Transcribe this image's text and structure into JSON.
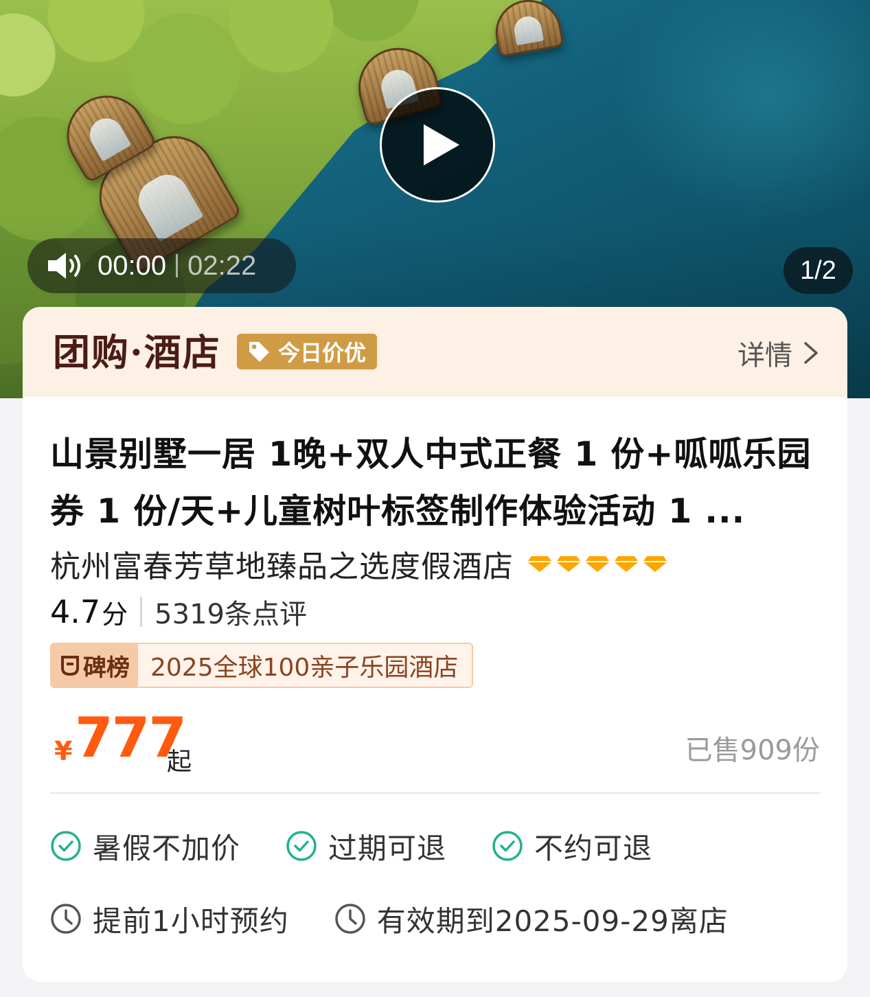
{
  "media": {
    "current_time": "00:00",
    "total_time": "02:22",
    "page_counter": "1/2"
  },
  "header": {
    "brand_title": "团购·酒店",
    "deal_badge": "今日价优",
    "details_label": "详情"
  },
  "deal": {
    "title": "山景别墅一居 1晚+双人中式正餐 1 份+呱呱乐园券 1 份/天+儿童树叶标签制作体验活动 1 ...",
    "hotel_name": "杭州富春芳草地臻品之选度假酒店",
    "diamond_count": 5,
    "rating": "4.7",
    "rating_unit": "分",
    "review_count": "5319条点评",
    "ranking_label": "碑榜",
    "ranking_text": "2025全球100亲子乐园酒店"
  },
  "price": {
    "currency": "¥",
    "value": "777",
    "suffix": "起",
    "sold": "已售909份"
  },
  "policies": [
    "暑假不加价",
    "过期可退",
    "不约可退"
  ],
  "booking": {
    "advance": "提前1小时预约",
    "validity": "有效期到2025-09-29离店"
  },
  "colors": {
    "price_orange": "#ff5a10",
    "badge_gold": "#d09b45",
    "diamond": "#ffa500",
    "check_green": "#21b28a",
    "header_bg": "#fdf0e4"
  }
}
